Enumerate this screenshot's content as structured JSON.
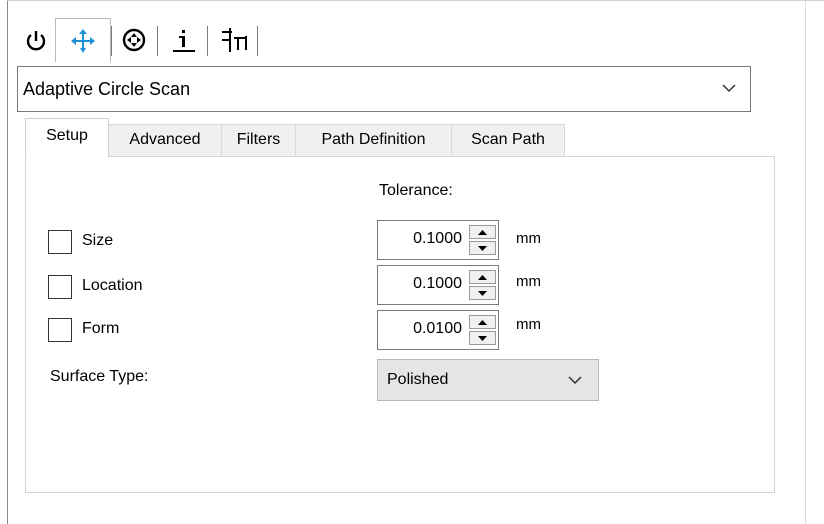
{
  "top_tabs": [
    {
      "icon": "power-icon"
    },
    {
      "icon": "move-arrows-icon",
      "active": true
    },
    {
      "icon": "circle-scan-icon"
    },
    {
      "icon": "info-icon"
    },
    {
      "icon": "hierarchy-icon"
    }
  ],
  "probe_type": {
    "value": "Adaptive Circle Scan"
  },
  "subtabs": [
    "Setup",
    "Advanced",
    "Filters",
    "Path Definition",
    "Scan Path"
  ],
  "active_subtab": "Setup",
  "setup": {
    "tolerance_label": "Tolerance:",
    "rows": [
      {
        "label": "Size",
        "checked": false,
        "value": "0.1000",
        "unit": "mm"
      },
      {
        "label": "Location",
        "checked": false,
        "value": "0.1000",
        "unit": "mm"
      },
      {
        "label": "Form",
        "checked": false,
        "value": "0.0100",
        "unit": "mm"
      }
    ],
    "surface_type_label": "Surface Type:",
    "surface_type_value": "Polished"
  },
  "colors": {
    "accent_icon": "#1e90d8",
    "panel_border": "#d4d4d4",
    "combo_bg": "#e5e5e5"
  }
}
